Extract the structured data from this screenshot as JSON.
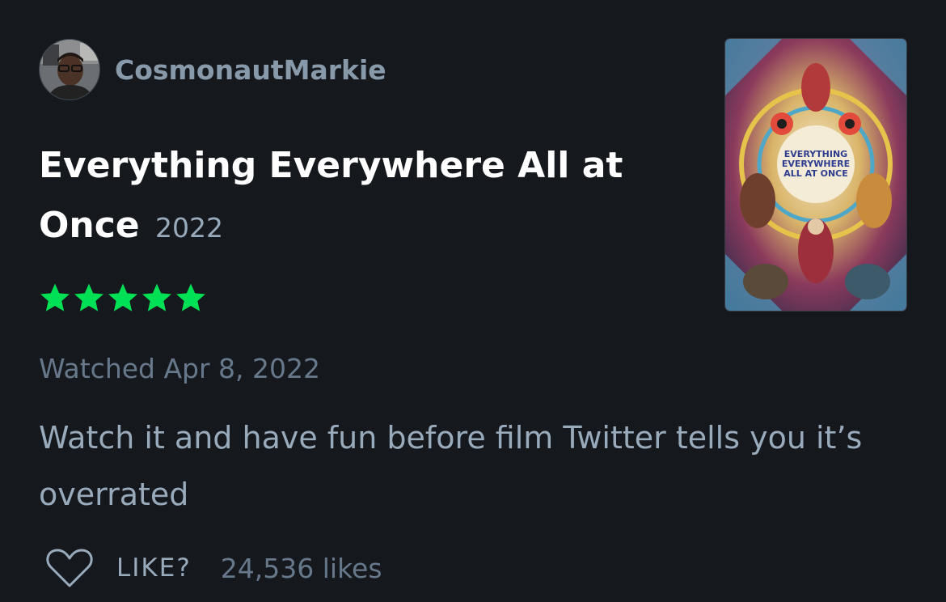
{
  "review": {
    "author": {
      "username": "CosmonautMarkie",
      "avatar_icon": "user-avatar"
    },
    "film": {
      "title": "Everything Everywhere All at Once",
      "year": "2022",
      "poster_text": [
        "EVERYTHING",
        "EVERYWHERE",
        "ALL AT ONCE"
      ]
    },
    "rating": {
      "stars": 5,
      "max_stars": 5,
      "star_color": "#00e054"
    },
    "watched": "Watched Apr 8, 2022",
    "body": "Watch it and have fun before film Twitter tells you it’s overrated",
    "actions": {
      "like_label": "LIKE?",
      "likes_count": "24,536 likes",
      "heart_icon": "heart-outline-icon"
    }
  },
  "colors": {
    "background": "#15191e",
    "username": "#8899aa",
    "muted": "#67788a",
    "body_text": "#99aabb",
    "accent_green": "#00e054"
  }
}
